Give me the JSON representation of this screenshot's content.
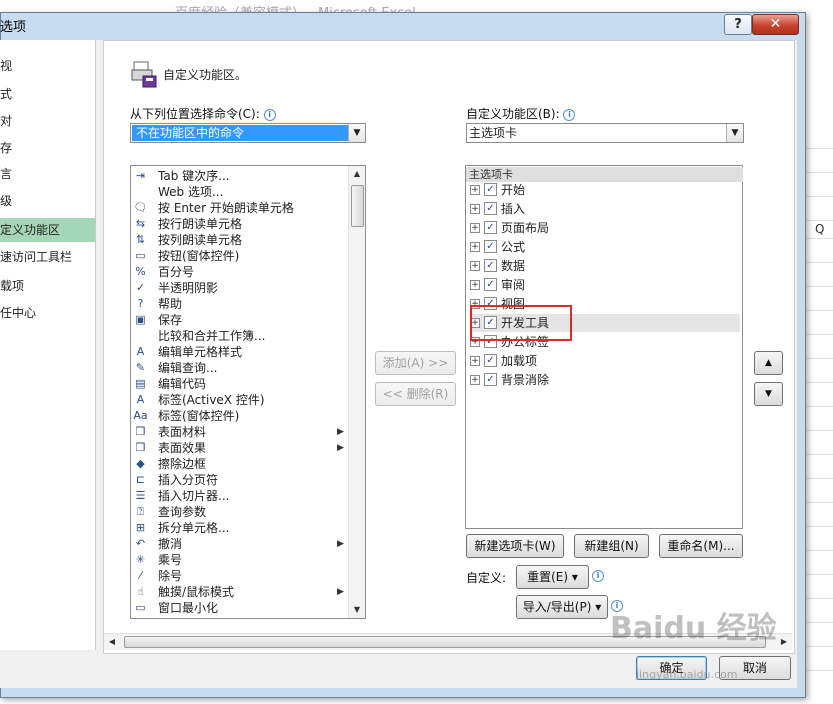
{
  "background": {
    "title": "百度经验（兼容模式） - Microsoft Excel",
    "cell_q": "Q"
  },
  "dialog": {
    "title": "选项",
    "help_label": "?",
    "close_label": "✕"
  },
  "nav": {
    "items": [
      {
        "label": "视"
      },
      {
        "label": "式"
      },
      {
        "label": "对"
      },
      {
        "label": "存"
      },
      {
        "label": "言"
      },
      {
        "label": "级"
      },
      {
        "label": "定义功能区"
      },
      {
        "label": "速访问工具栏"
      },
      {
        "label": "载项"
      },
      {
        "label": "任中心"
      }
    ]
  },
  "main": {
    "header": "自定义功能区。",
    "left_label": "从下列位置选择命令(C):",
    "left_combo_value": "不在功能区中的命令",
    "right_label": "自定义功能区(B):",
    "right_combo_value": "主选项卡",
    "commands": [
      {
        "icon": "tab-order-icon",
        "glyph": "⇥",
        "label": "Tab 键次序..."
      },
      {
        "icon": "web-options-icon",
        "glyph": "",
        "label": "Web 选项..."
      },
      {
        "icon": "speak-enter-icon",
        "glyph": "🗨",
        "label": "按 Enter 开始朗读单元格"
      },
      {
        "icon": "speak-rows-icon",
        "glyph": "⇆",
        "label": "按行朗读单元格"
      },
      {
        "icon": "speak-columns-icon",
        "glyph": "⇅",
        "label": "按列朗读单元格"
      },
      {
        "icon": "form-button-icon",
        "glyph": "▭",
        "label": "按钮(窗体控件)"
      },
      {
        "icon": "percent-icon",
        "glyph": "%",
        "label": "百分号"
      },
      {
        "icon": "semi-transparent-shadow-icon",
        "glyph": "✓",
        "label": "半透明阴影"
      },
      {
        "icon": "help-icon",
        "glyph": "?",
        "label": "帮助"
      },
      {
        "icon": "save-icon",
        "glyph": "▣",
        "label": "保存"
      },
      {
        "icon": "compare-merge-icon",
        "glyph": "",
        "label": "比较和合并工作簿..."
      },
      {
        "icon": "edit-cell-style-icon",
        "glyph": "A",
        "label": "编辑单元格样式"
      },
      {
        "icon": "edit-query-icon",
        "glyph": "✎",
        "label": "编辑查询..."
      },
      {
        "icon": "edit-code-icon",
        "glyph": "▤",
        "label": "编辑代码"
      },
      {
        "icon": "activex-label-icon",
        "glyph": "A",
        "label": "标签(ActiveX 控件)"
      },
      {
        "icon": "form-label-icon",
        "glyph": "Aa",
        "label": "标签(窗体控件)"
      },
      {
        "icon": "surface-material-icon",
        "glyph": "❒",
        "label": "表面材料",
        "submenu": true
      },
      {
        "icon": "surface-effect-icon",
        "glyph": "❒",
        "label": "表面效果",
        "submenu": true
      },
      {
        "icon": "eraser-icon",
        "glyph": "◆",
        "label": "擦除边框"
      },
      {
        "icon": "page-break-icon",
        "glyph": "⊏",
        "label": "插入分页符"
      },
      {
        "icon": "slicer-icon",
        "glyph": "☰",
        "label": "插入切片器..."
      },
      {
        "icon": "query-params-icon",
        "glyph": "⍰",
        "label": "查询参数"
      },
      {
        "icon": "split-cells-icon",
        "glyph": "⊞",
        "label": "拆分单元格..."
      },
      {
        "icon": "undo-icon",
        "glyph": "↶",
        "label": "撤消",
        "submenu": true
      },
      {
        "icon": "multiply-icon",
        "glyph": "✳",
        "label": "乘号"
      },
      {
        "icon": "divide-icon",
        "glyph": "⁄",
        "label": "除号"
      },
      {
        "icon": "touch-mouse-mode-icon",
        "glyph": "☝",
        "label": "触摸/鼠标模式",
        "submenu": true
      },
      {
        "icon": "window-minimize-icon",
        "glyph": "▭",
        "label": "窗口最小化"
      }
    ],
    "tree_header": "主选项卡",
    "tabs": [
      {
        "label": "开始",
        "checked": true
      },
      {
        "label": "插入",
        "checked": true
      },
      {
        "label": "页面布局",
        "checked": true
      },
      {
        "label": "公式",
        "checked": true
      },
      {
        "label": "数据",
        "checked": true
      },
      {
        "label": "审阅",
        "checked": true
      },
      {
        "label": "视图",
        "checked": true
      },
      {
        "label": "开发工具",
        "checked": true
      },
      {
        "label": "办公标签",
        "checked": true
      },
      {
        "label": "加载项",
        "checked": true
      },
      {
        "label": "背景消除",
        "checked": true
      }
    ],
    "add_button": "添加(A) >>",
    "remove_button": "<< 删除(R)",
    "new_tab_button": "新建选项卡(W)",
    "new_group_button": "新建组(N)",
    "rename_button": "重命名(M)...",
    "customize_label": "自定义:",
    "reset_button": "重置(E) ▾",
    "import_export_button": "导入/导出(P) ▾",
    "up_arrow": "▲",
    "down_arrow": "▼"
  },
  "footer": {
    "ok_button": "确定",
    "cancel_button": "取消"
  },
  "watermark": {
    "brand": "Baidu 经验",
    "url": "jingyan.baidu.com"
  }
}
